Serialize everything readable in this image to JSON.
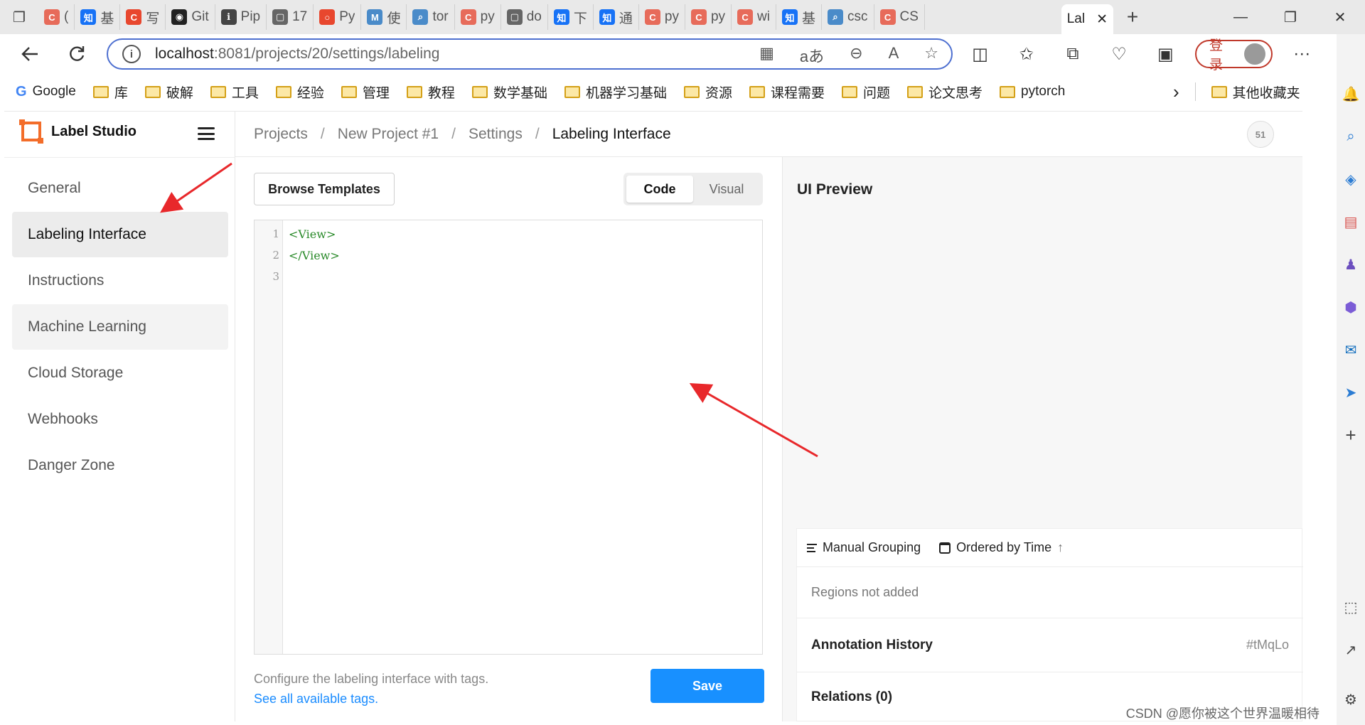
{
  "browser": {
    "tabs": [
      {
        "label": "(",
        "icon_color": "#e76b5a",
        "icon_char": "C"
      },
      {
        "label": "基",
        "icon_color": "#1772f6",
        "icon_char": "知"
      },
      {
        "label": "写",
        "icon_color": "#e8472e",
        "icon_char": "C"
      },
      {
        "label": "Git",
        "icon_color": "#222222",
        "icon_char": "◉"
      },
      {
        "label": "Pip",
        "icon_color": "#444444",
        "icon_char": "ℹ"
      },
      {
        "label": "17",
        "icon_color": "#666666",
        "icon_char": "▢"
      },
      {
        "label": "Py",
        "icon_color": "#e8472e",
        "icon_char": "○"
      },
      {
        "label": "使",
        "icon_color": "#4a8bc9",
        "icon_char": "M"
      },
      {
        "label": "tor",
        "icon_color": "#4a8bc9",
        "icon_char": "⌕"
      },
      {
        "label": "py",
        "icon_color": "#e76b5a",
        "icon_char": "C"
      },
      {
        "label": "do",
        "icon_color": "#666666",
        "icon_char": "▢"
      },
      {
        "label": "下",
        "icon_color": "#1772f6",
        "icon_char": "知"
      },
      {
        "label": "通",
        "icon_color": "#1772f6",
        "icon_char": "知"
      },
      {
        "label": "py",
        "icon_color": "#e76b5a",
        "icon_char": "C"
      },
      {
        "label": "py",
        "icon_color": "#e76b5a",
        "icon_char": "C"
      },
      {
        "label": "wi",
        "icon_color": "#e76b5a",
        "icon_char": "C"
      },
      {
        "label": "基",
        "icon_color": "#1772f6",
        "icon_char": "知"
      },
      {
        "label": "csc",
        "icon_color": "#4a8bc9",
        "icon_char": "⌕"
      },
      {
        "label": "CS",
        "icon_color": "#e76b5a",
        "icon_char": "C"
      }
    ],
    "active_tab": {
      "label": "Lal",
      "close": "✕"
    },
    "new_tab": "+",
    "window_controls": {
      "minimize": "—",
      "maximize": "❐",
      "close": "✕"
    },
    "url_host": "localhost",
    "url_path": ":8081/projects/20/settings/labeling",
    "login_label": "登录",
    "bookmarks": [
      {
        "label": "Google",
        "icon": "google-icon"
      },
      {
        "label": "库",
        "icon": "folder-icon"
      },
      {
        "label": "破解",
        "icon": "folder-icon"
      },
      {
        "label": "工具",
        "icon": "folder-icon"
      },
      {
        "label": "经验",
        "icon": "folder-icon"
      },
      {
        "label": "管理",
        "icon": "folder-icon"
      },
      {
        "label": "教程",
        "icon": "folder-icon"
      },
      {
        "label": "数学基础",
        "icon": "folder-icon"
      },
      {
        "label": "机器学习基础",
        "icon": "folder-icon"
      },
      {
        "label": "资源",
        "icon": "folder-icon"
      },
      {
        "label": "课程需要",
        "icon": "folder-icon"
      },
      {
        "label": "问题",
        "icon": "folder-icon"
      },
      {
        "label": "论文思考",
        "icon": "folder-icon"
      },
      {
        "label": "pytorch",
        "icon": "folder-icon"
      }
    ],
    "bookmarks_overflow": "›",
    "other_bookmarks": "其他收藏夹"
  },
  "app": {
    "brand": "Label Studio",
    "breadcrumb": [
      "Projects",
      "New Project #1",
      "Settings",
      "Labeling Interface"
    ],
    "breadcrumb_sep": "/",
    "badge_count": "51",
    "menu": [
      {
        "label": "General",
        "state": "normal"
      },
      {
        "label": "Labeling Interface",
        "state": "active"
      },
      {
        "label": "Instructions",
        "state": "normal"
      },
      {
        "label": "Machine Learning",
        "state": "hover"
      },
      {
        "label": "Cloud Storage",
        "state": "normal"
      },
      {
        "label": "Webhooks",
        "state": "normal"
      },
      {
        "label": "Danger Zone",
        "state": "normal"
      }
    ]
  },
  "editor": {
    "browse_templates": "Browse Templates",
    "mode_code": "Code",
    "mode_visual": "Visual",
    "active_mode": "Code",
    "line_numbers": [
      "1",
      "2",
      "3"
    ],
    "code_lines": [
      "<View>",
      "</View>",
      ""
    ],
    "hint_text": "Configure the labeling interface with tags.",
    "hint_link": "See all available tags.",
    "save_label": "Save"
  },
  "preview": {
    "title": "UI Preview",
    "manual_grouping": "Manual Grouping",
    "ordered_by_time": "Ordered by Time",
    "sort_arrow": "↑",
    "regions_empty": "Regions not added",
    "annotation_history": "Annotation History",
    "annotation_id": "#tMqLo",
    "relations": "Relations (0)"
  },
  "watermark": "CSDN @愿你被这个世界温暖相待",
  "colors": {
    "accent": "#1890ff",
    "brand": "#f36d2a",
    "annotation_arrow": "#e8282b",
    "code_green": "#2a8a2a"
  }
}
